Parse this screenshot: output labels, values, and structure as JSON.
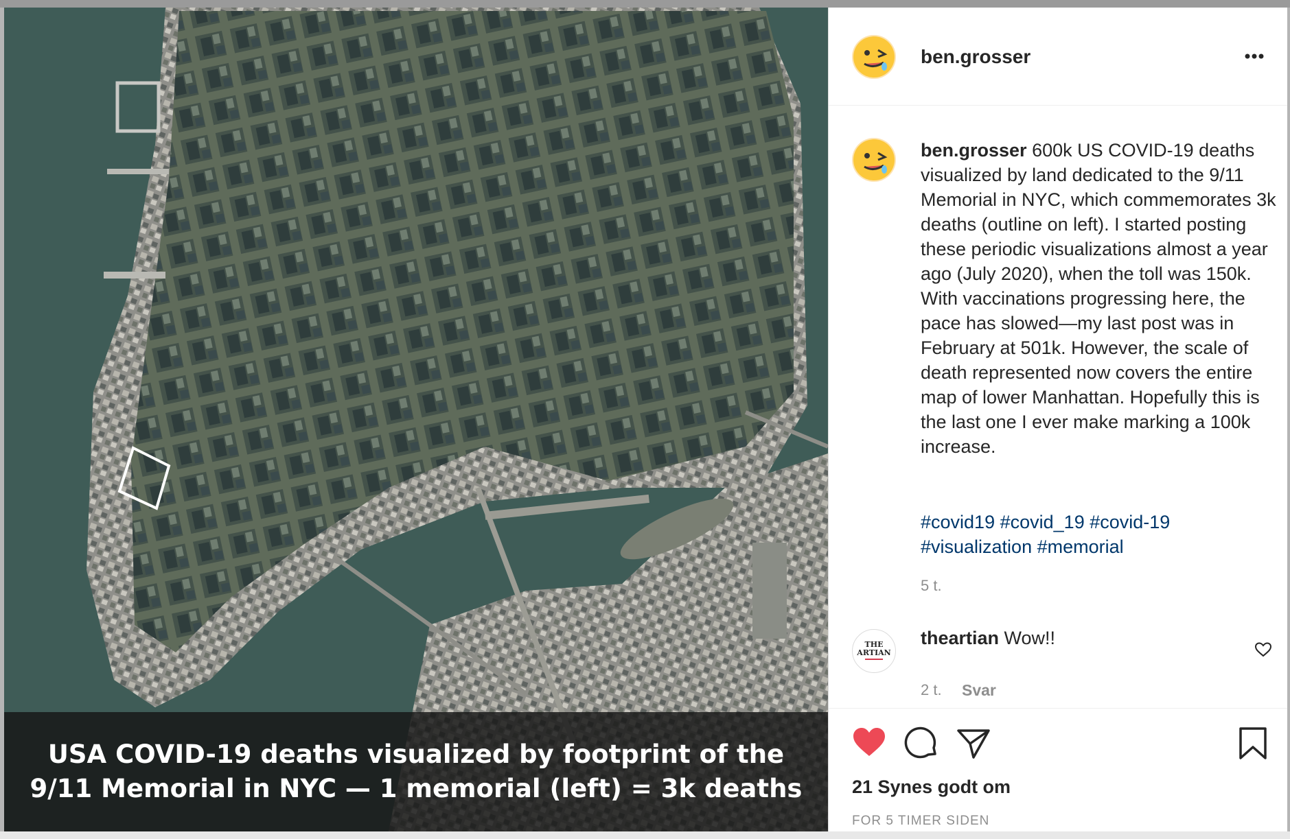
{
  "post": {
    "media_caption_line1": "USA COVID-19 deaths visualized by footprint of the",
    "media_caption_line2": "9/11 Memorial in NYC — 1 memorial (left) = 3k deaths",
    "author": "ben.grosser",
    "caption": "600k US COVID-19 deaths visualized by land dedicated to the 9/11 Memorial in NYC, which commemorates 3k deaths (outline on left). I started posting these periodic visualizations almost a year ago (July 2020), when the toll was 150k. With vaccinations progressing here, the pace has slowed—my last post was in February at 501k. However, the scale of death represented now covers the entire map of lower Manhattan. Hopefully this is the last one I ever make marking a 100k increase.",
    "hashtags": [
      "#covid19",
      "#covid_19",
      "#covid-19",
      "#visualization",
      "#memorial"
    ],
    "caption_time": "5 t.",
    "likes_text": "21 Synes godt om",
    "posted_ago": "FOR 5 TIMER SIDEN"
  },
  "comment": {
    "author": "theartian",
    "avatar_text_1": "THE",
    "avatar_text_2": "ARTIAN",
    "text": "Wow!!",
    "time": "2 t.",
    "reply_label": "Svar"
  },
  "colors": {
    "like_red": "#ed4956",
    "hashtag_blue": "#00376b",
    "muted_gray": "#8e8e8e"
  },
  "icons": [
    "more-icon",
    "heart-filled-icon",
    "comment-icon",
    "share-icon",
    "bookmark-icon",
    "heart-outline-icon"
  ]
}
